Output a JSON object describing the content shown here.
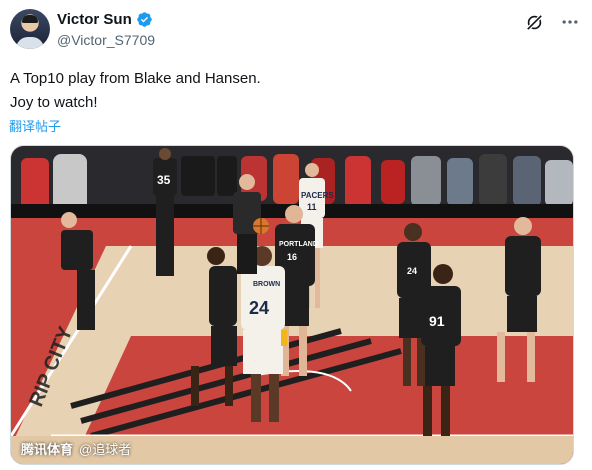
{
  "author": {
    "display_name": "Victor Sun",
    "handle": "@Victor_S7709",
    "verified": true,
    "verified_color": "#1d9bf0"
  },
  "actions": {
    "grok_icon": "grok-icon",
    "more_icon": "more-icon"
  },
  "tweet": {
    "line1": "A Top10 play from Blake and Hansen.",
    "line2": "Joy to watch!",
    "translate_label": "翻译帖子"
  },
  "media": {
    "type": "video-frame",
    "watermark_logo": "腾讯体育",
    "watermark_text": "@追球者",
    "jersey_numbers": [
      "35",
      "16",
      "24",
      "24",
      "91",
      "11"
    ],
    "jersey_team_text": [
      "PORTLAND",
      "PACERS",
      "PORTLAND",
      "BROWN"
    ],
    "court_text": "RIP CITY",
    "colors": {
      "court_red": "#c9453d",
      "court_wood": "#e8d2b4",
      "blazers_black": "#1f1f1f",
      "pacers_white": "#f4f1ea",
      "pacers_gold": "#f2b51c"
    }
  }
}
